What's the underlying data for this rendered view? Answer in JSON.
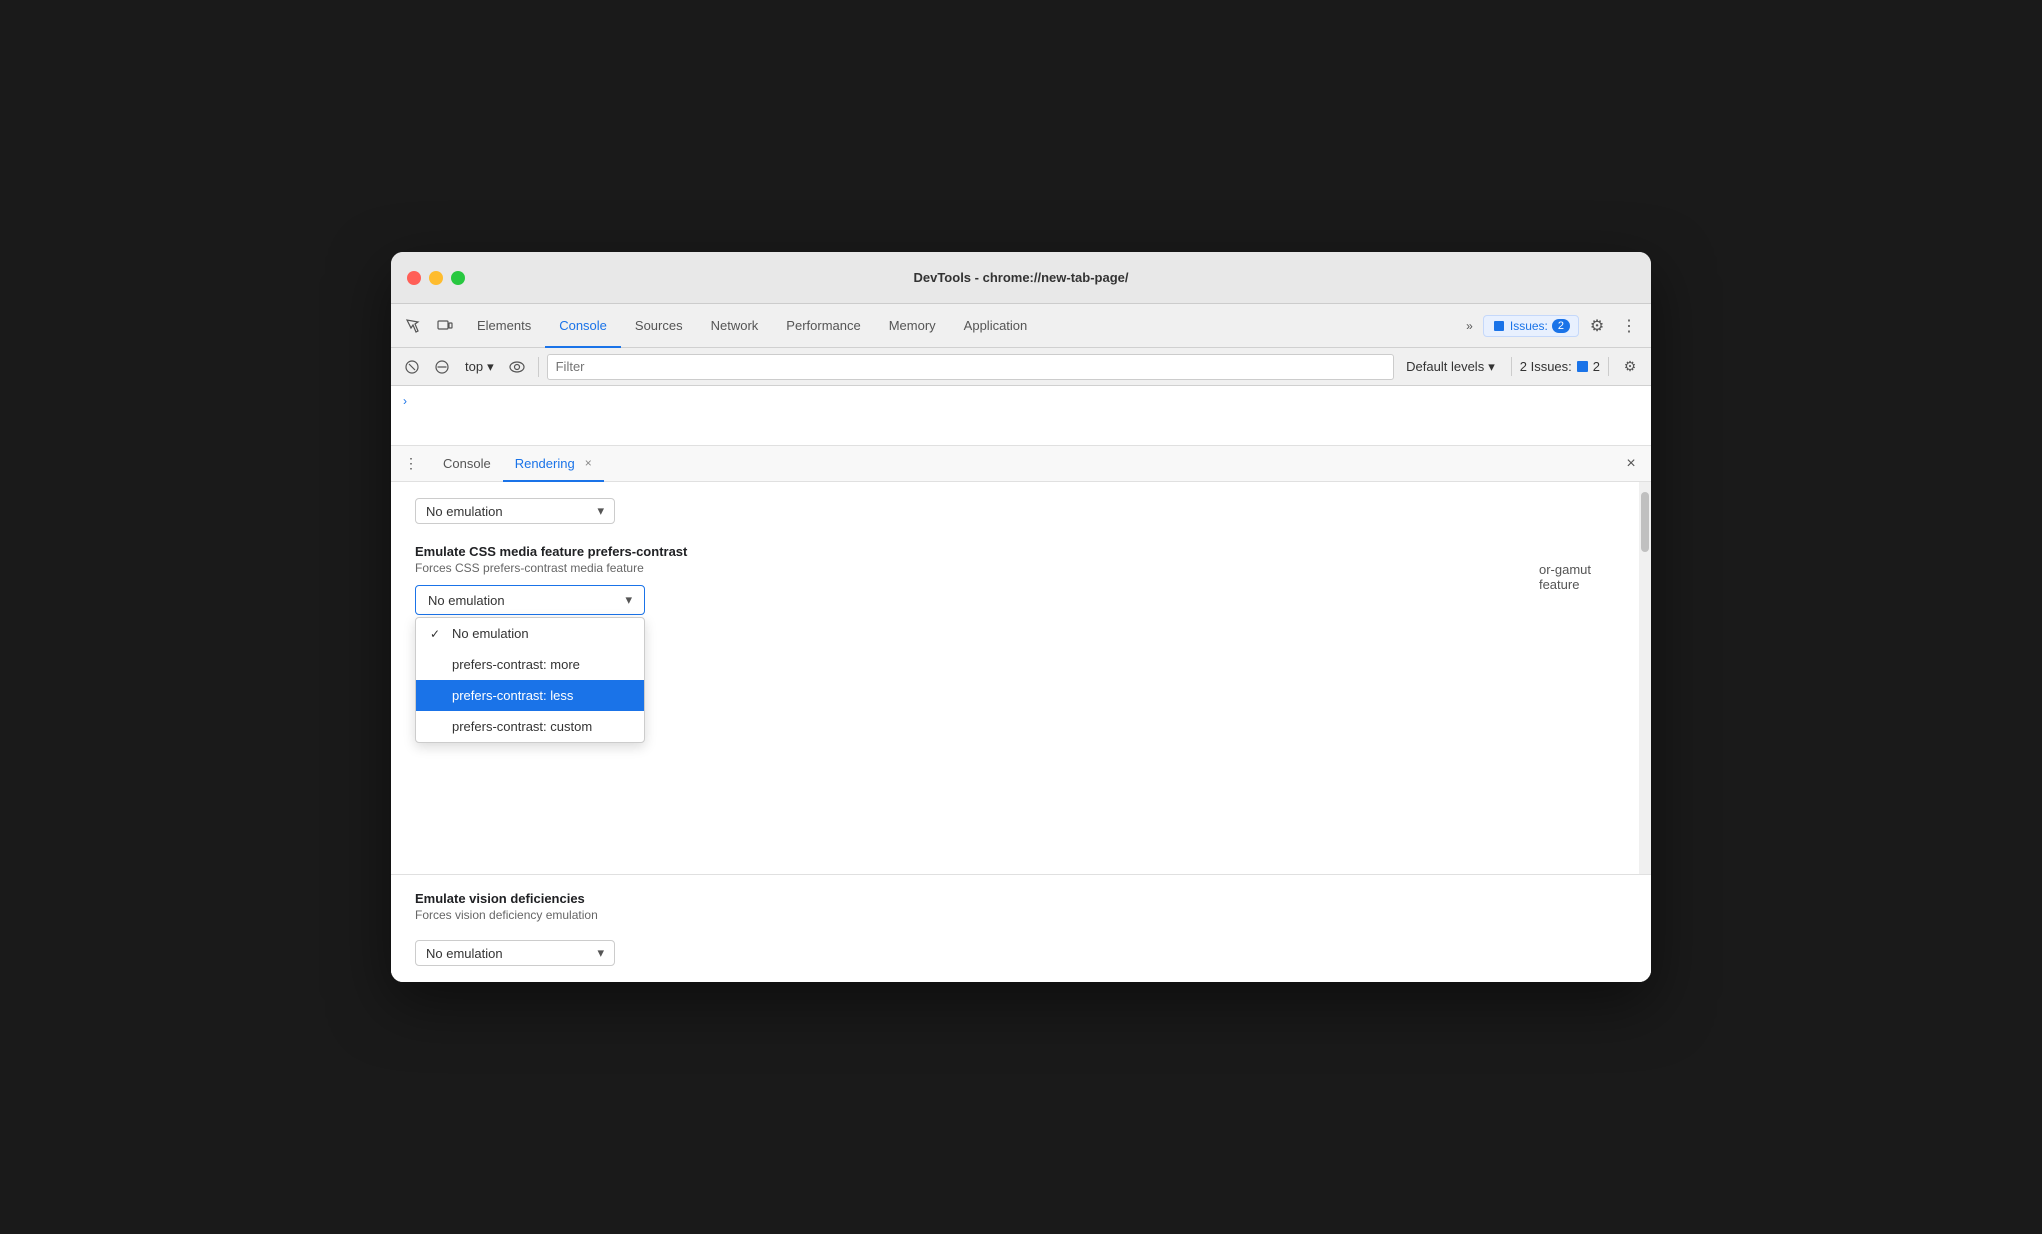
{
  "window": {
    "title": "DevTools - chrome://new-tab-page/"
  },
  "tabs": {
    "items": [
      {
        "label": "Elements",
        "active": false
      },
      {
        "label": "Console",
        "active": true
      },
      {
        "label": "Sources",
        "active": false
      },
      {
        "label": "Network",
        "active": false
      },
      {
        "label": "Performance",
        "active": false
      },
      {
        "label": "Memory",
        "active": false
      },
      {
        "label": "Application",
        "active": false
      }
    ],
    "more_label": "»",
    "issues_label": "Issues:",
    "issues_count": "2",
    "settings_label": "⚙",
    "more_options_label": "⋮"
  },
  "console_toolbar": {
    "top_label": "top",
    "filter_placeholder": "Filter",
    "levels_label": "Default levels",
    "issues_prefix": "2 Issues:",
    "issues_count": "2"
  },
  "panel_tabs": {
    "console_label": "Console",
    "rendering_label": "Rendering",
    "close_label": "×"
  },
  "rendering": {
    "prefers_contrast": {
      "section_title": "Emulate CSS media feature prefers-contrast",
      "section_desc": "Forces CSS prefers-contrast media feature",
      "dropdown_value": "No emulation",
      "options": [
        {
          "label": "No emulation",
          "checked": true,
          "highlighted": false
        },
        {
          "label": "prefers-contrast: more",
          "checked": false,
          "highlighted": false
        },
        {
          "label": "prefers-contrast: less",
          "checked": false,
          "highlighted": true
        },
        {
          "label": "prefers-contrast: custom",
          "checked": false,
          "highlighted": false
        }
      ]
    },
    "color_scheme": {
      "dropdown_value": "No emulation"
    },
    "vision": {
      "section_title": "Emulate vision deficiencies",
      "section_desc": "Forces vision deficiency emulation",
      "dropdown_value": "No emulation"
    },
    "right_partial": {
      "line1": "or-gamut",
      "line2": "feature"
    }
  }
}
